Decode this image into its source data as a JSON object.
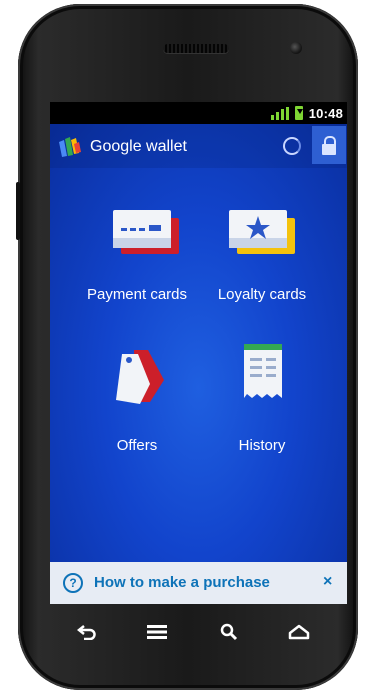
{
  "status_bar": {
    "time": "10:48",
    "signal_icon": "signal-icon",
    "battery_icon": "battery-charging-icon"
  },
  "app": {
    "title": "Google wallet",
    "logo_icon": "google-wallet-logo",
    "sync_icon": "sync-spinner-icon",
    "lock_icon": "lock-icon"
  },
  "tiles": [
    {
      "label": "Payment cards",
      "icon": "payment-cards-icon"
    },
    {
      "label": "Loyalty cards",
      "icon": "loyalty-cards-icon"
    },
    {
      "label": "Offers",
      "icon": "offers-tag-icon"
    },
    {
      "label": "History",
      "icon": "history-receipt-icon"
    }
  ],
  "help_bar": {
    "text": "How to make a purchase",
    "help_icon": "question-icon",
    "close_icon": "close-icon",
    "close_symbol": "×",
    "question_symbol": "?"
  },
  "nav_bar": {
    "icons": [
      "back-icon",
      "menu-icon",
      "search-icon",
      "home-icon"
    ]
  },
  "colors": {
    "app_bg": "#1244cc",
    "help_text": "#0e73b8",
    "signal": "#7fd633"
  }
}
